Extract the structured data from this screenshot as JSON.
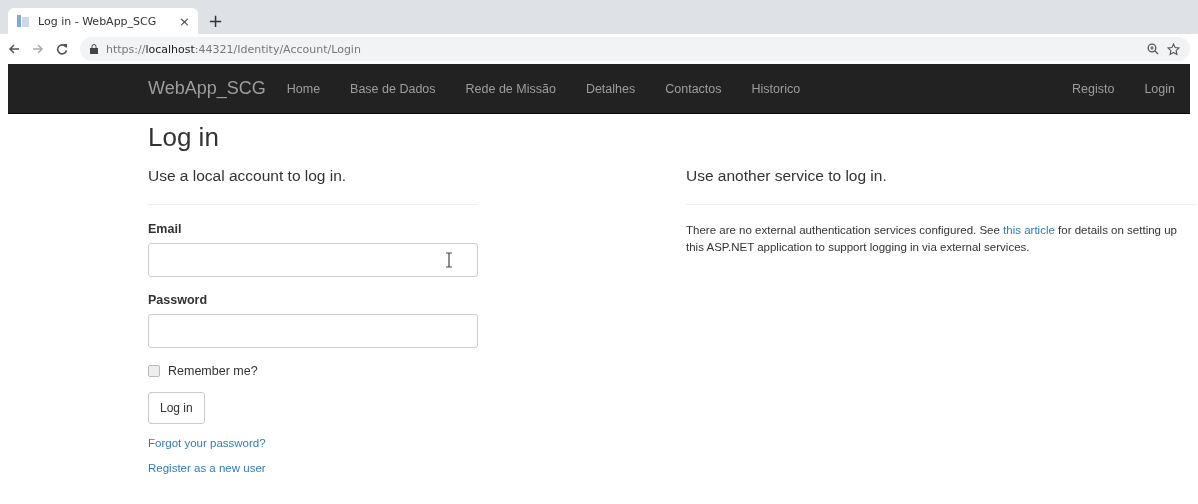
{
  "browser": {
    "tab": {
      "title": "Log in - WebApp_SCG",
      "close": "×",
      "selected": true
    },
    "new_tab": "+",
    "address": {
      "scheme": "https://",
      "host": "localhost",
      "path": ":44321/Identity/Account/Login"
    }
  },
  "navbar": {
    "brand": "WebApp_SCG",
    "links": [
      {
        "label": "Home"
      },
      {
        "label": "Base de Dados"
      },
      {
        "label": "Rede de Missão"
      },
      {
        "label": "Detalhes"
      },
      {
        "label": "Contactos"
      },
      {
        "label": "Historico"
      }
    ],
    "right_links": [
      {
        "label": "Registo"
      },
      {
        "label": "Login"
      }
    ]
  },
  "page": {
    "title": "Log in",
    "local": {
      "heading": "Use a local account to log in.",
      "fields": [
        {
          "label": "Email",
          "kind": "text"
        },
        {
          "label": "Password",
          "kind": "password"
        }
      ],
      "remember": {
        "label": "Remember me?",
        "checked": false
      },
      "submit": "Log in",
      "links": [
        "Forgot your password?",
        "Register as a new user"
      ]
    },
    "external": {
      "heading": "Use another service to log in.",
      "text_before": "There are no external authentication services configured. See ",
      "link": "this article",
      "text_after": " for details on setting up this ASP.NET application to support logging in via external services."
    }
  }
}
